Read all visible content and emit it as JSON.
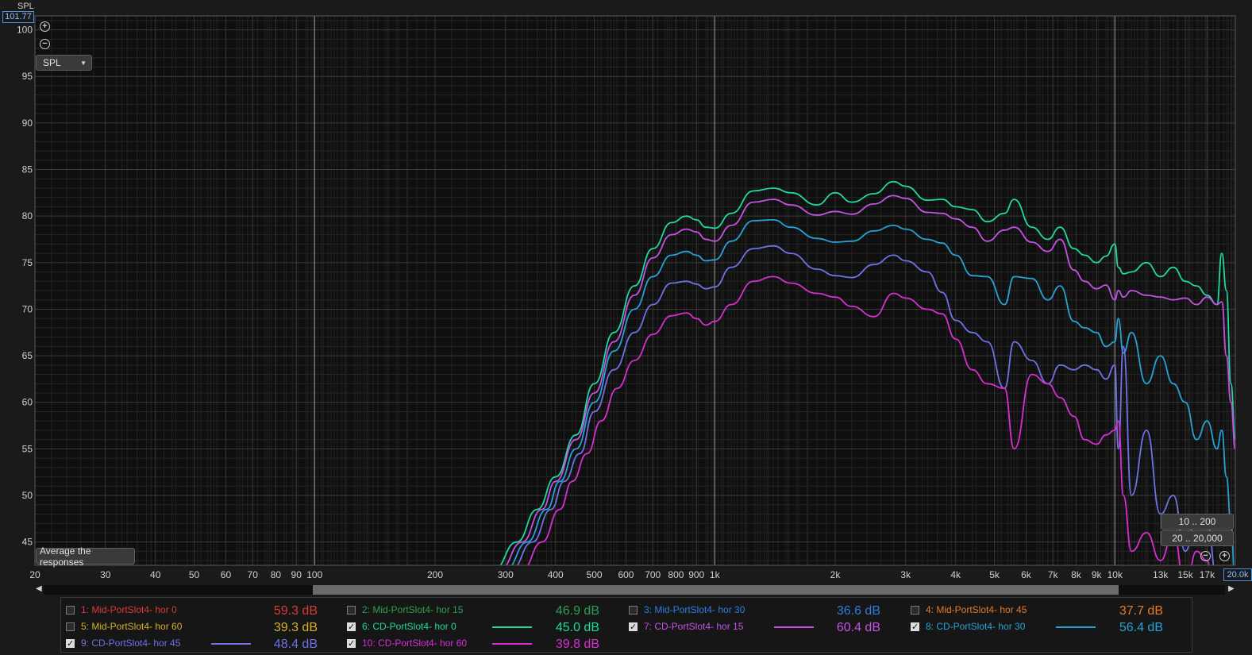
{
  "chart_data": {
    "type": "line",
    "title": "",
    "xlabel": "",
    "ylabel": "SPL",
    "x_scale": "log",
    "xlim": [
      20,
      20000
    ],
    "ylim": [
      42.5,
      101.5
    ],
    "y_ticks": [
      "100",
      "95",
      "90",
      "85",
      "80",
      "75",
      "70",
      "65",
      "60",
      "55",
      "50",
      "45"
    ],
    "x_ticks": [
      "20",
      "30",
      "40",
      "50",
      "60",
      "70",
      "80",
      "90",
      "100",
      "200",
      "300",
      "400",
      "500",
      "600",
      "700",
      "800",
      "900",
      "1k",
      "2k",
      "3k",
      "4k",
      "5k",
      "6k",
      "7k",
      "8k",
      "9k",
      "10k",
      "13k",
      "15k",
      "17k"
    ],
    "grid": true,
    "series": [
      {
        "name": "6: CD-PortSlot4- hor 0",
        "color": "#1fd9a0",
        "x": [
          280,
          320,
          360,
          400,
          450,
          500,
          560,
          630,
          700,
          780,
          850,
          900,
          950,
          1000,
          1100,
          1250,
          1400,
          1550,
          1800,
          2000,
          2200,
          2500,
          2800,
          3000,
          3400,
          3700,
          4000,
          4400,
          4800,
          5300,
          5600,
          6200,
          6800,
          7300,
          7900,
          8400,
          9000,
          9500,
          10000,
          10200,
          10500,
          11000,
          12000,
          13000,
          14000,
          15000,
          16000,
          17000,
          18000,
          18500,
          19000,
          19500,
          20000
        ],
        "y": [
          42,
          45,
          48.5,
          52,
          56.5,
          62,
          67.5,
          72.5,
          76.5,
          79.3,
          80,
          79.6,
          78.8,
          78.7,
          80.3,
          82.7,
          83,
          82.5,
          81.2,
          82.5,
          81.5,
          82.4,
          83.7,
          83.2,
          81.7,
          81.8,
          81,
          80.7,
          79.4,
          80.3,
          81.8,
          78.8,
          77.5,
          78.8,
          76.5,
          75.8,
          75,
          75.7,
          77,
          74.5,
          73.8,
          74,
          75,
          73.5,
          74.5,
          73,
          72.5,
          71.5,
          70.5,
          76,
          72,
          62,
          56
        ]
      },
      {
        "name": "7: CD-PortSlot4- hor 15",
        "color": "#c651e6",
        "x": [
          290,
          330,
          370,
          400,
          450,
          500,
          560,
          630,
          700,
          780,
          850,
          900,
          950,
          1000,
          1100,
          1250,
          1400,
          1550,
          1800,
          2000,
          2200,
          2500,
          2800,
          3000,
          3400,
          3700,
          4000,
          4400,
          4800,
          5300,
          5600,
          6200,
          6800,
          7300,
          7900,
          8400,
          9000,
          9500,
          10000,
          10200,
          10500,
          11000,
          12000,
          13000,
          14000,
          15000,
          16000,
          17000,
          18000,
          18500,
          19000,
          19500,
          20000
        ],
        "y": [
          42,
          45,
          48.5,
          51.5,
          56,
          61,
          66.5,
          71.5,
          75.5,
          78,
          78.6,
          78.3,
          77.5,
          77.3,
          79,
          81.5,
          81.8,
          81.2,
          80.1,
          80.5,
          80.2,
          81.3,
          82.2,
          81.9,
          80.4,
          80.3,
          79.7,
          78.8,
          77.3,
          78.5,
          78.8,
          77.2,
          76.2,
          77.5,
          74.2,
          73,
          72.2,
          72.6,
          71,
          72,
          71.3,
          72,
          71.5,
          71.3,
          71,
          71.2,
          70.5,
          71.3,
          70.5,
          70.8,
          65,
          60,
          55
        ]
      },
      {
        "name": "8: CD-PortSlot4- hor 30",
        "color": "#25a3d6",
        "x": [
          300,
          340,
          380,
          410,
          450,
          500,
          560,
          630,
          700,
          780,
          850,
          900,
          950,
          1000,
          1100,
          1250,
          1400,
          1550,
          1800,
          2000,
          2200,
          2500,
          2800,
          3000,
          3400,
          3700,
          4000,
          4400,
          4800,
          5300,
          5600,
          6200,
          6800,
          7300,
          7900,
          8400,
          9000,
          9500,
          10000,
          10200,
          10500,
          11000,
          12000,
          13000,
          14000,
          15000,
          16000,
          17000,
          18000,
          18500,
          19000,
          19500,
          20000
        ],
        "y": [
          42,
          45,
          48.5,
          51.5,
          55,
          60,
          65.5,
          70,
          73.5,
          75.8,
          76.2,
          75.8,
          75.2,
          75.3,
          77.3,
          79.5,
          79.6,
          78.8,
          77.6,
          77.2,
          77.3,
          78.4,
          79,
          78.6,
          77.5,
          77.1,
          75.8,
          73.6,
          73.5,
          70.5,
          73.5,
          73.3,
          71,
          72.5,
          68.7,
          68,
          67.5,
          66,
          66.5,
          69,
          65.3,
          67.5,
          62,
          65,
          62,
          60,
          56,
          58,
          55,
          57,
          52,
          47,
          40
        ]
      },
      {
        "name": "9: CD-PortSlot4- hor 45",
        "color": "#6f72e6",
        "x": [
          310,
          350,
          390,
          420,
          460,
          500,
          560,
          630,
          700,
          780,
          850,
          900,
          950,
          1000,
          1100,
          1250,
          1400,
          1550,
          1800,
          2000,
          2200,
          2500,
          2800,
          3000,
          3400,
          3700,
          4000,
          4400,
          4800,
          5300,
          5600,
          6200,
          6800,
          7300,
          7900,
          8400,
          9000,
          9500,
          10000,
          10200,
          10500,
          11000,
          12000,
          13000,
          14000,
          15000,
          16000,
          17000,
          18000,
          18500,
          19000,
          19500,
          20000
        ],
        "y": [
          42,
          45,
          48.5,
          51.5,
          54.5,
          59,
          63.5,
          67.5,
          70.5,
          72.8,
          73,
          72.7,
          72.2,
          72.4,
          74.5,
          76.5,
          76.8,
          76,
          74.3,
          73.6,
          73.4,
          74.8,
          75.8,
          75.2,
          74,
          71.8,
          68.8,
          67.5,
          66.5,
          61.5,
          66.5,
          64.5,
          62,
          64,
          63.5,
          64,
          63.5,
          62.5,
          64,
          55,
          66,
          50,
          57,
          48,
          50,
          44,
          48,
          47,
          41,
          38,
          36,
          34,
          33
        ]
      },
      {
        "name": "10: CD-PortSlot4- hor 60",
        "color": "#d72ed2",
        "x": [
          330,
          370,
          410,
          440,
          480,
          520,
          570,
          630,
          700,
          780,
          850,
          900,
          950,
          1000,
          1100,
          1250,
          1400,
          1550,
          1800,
          2000,
          2200,
          2500,
          2800,
          3000,
          3400,
          3700,
          4000,
          4400,
          4800,
          5300,
          5600,
          6200,
          6800,
          7300,
          7900,
          8400,
          9000,
          9500,
          10000,
          10200,
          10500,
          11000,
          12000,
          13000,
          14000,
          15000,
          16000,
          17000,
          18000,
          18500,
          19000,
          19500,
          20000
        ],
        "y": [
          42,
          45,
          48.5,
          51.5,
          54.5,
          58,
          61.5,
          64.5,
          67.3,
          69.3,
          69.6,
          69,
          68.3,
          68.7,
          70.5,
          73,
          73.5,
          72.8,
          71.7,
          71.3,
          70.3,
          69.2,
          71.7,
          71.2,
          70,
          69.5,
          66.8,
          63.5,
          62,
          61.5,
          55,
          63,
          62,
          60.5,
          58.5,
          56,
          55.5,
          56.5,
          57,
          58,
          50,
          44,
          46,
          43,
          46,
          40,
          44,
          43,
          35,
          33,
          31,
          30,
          30
        ]
      }
    ]
  },
  "ui": {
    "cursor_readout": "101.77",
    "x_end_readout": "20.0k",
    "dropdown_label": "SPL",
    "average_button": "Average the responses",
    "range_btn_1": "10 .. 200",
    "range_btn_2": "20 .. 20,000"
  },
  "legend": [
    {
      "label": "1: Mid-PortSlot4- hor 0",
      "value": "59.3 dB",
      "color": "#d83a3a",
      "checked": false
    },
    {
      "label": "2: Mid-PortSlot4- hor 15",
      "value": "46.9 dB",
      "color": "#2e9e52",
      "checked": false
    },
    {
      "label": "3: Mid-PortSlot4- hor 30",
      "value": "36.6 dB",
      "color": "#2d7de0",
      "checked": false
    },
    {
      "label": "4: Mid-PortSlot4- hor 45",
      "value": "37.7 dB",
      "color": "#e87a26",
      "checked": false
    },
    {
      "label": "5: Mid-PortSlot4- hor 60",
      "value": "39.3 dB",
      "color": "#d4b02a",
      "checked": false
    },
    {
      "label": "6: CD-PortSlot4- hor 0",
      "value": "45.0 dB",
      "color": "#1fd9a0",
      "checked": true
    },
    {
      "label": "7: CD-PortSlot4- hor 15",
      "value": "60.4 dB",
      "color": "#c651e6",
      "checked": true
    },
    {
      "label": "8: CD-PortSlot4- hor 30",
      "value": "56.4 dB",
      "color": "#25a3d6",
      "checked": true
    },
    {
      "label": "9: CD-PortSlot4- hor 45",
      "value": "48.4 dB",
      "color": "#6f72e6",
      "checked": true
    },
    {
      "label": "10: CD-PortSlot4- hor 60",
      "value": "39.8 dB",
      "color": "#d72ed2",
      "checked": true
    }
  ]
}
